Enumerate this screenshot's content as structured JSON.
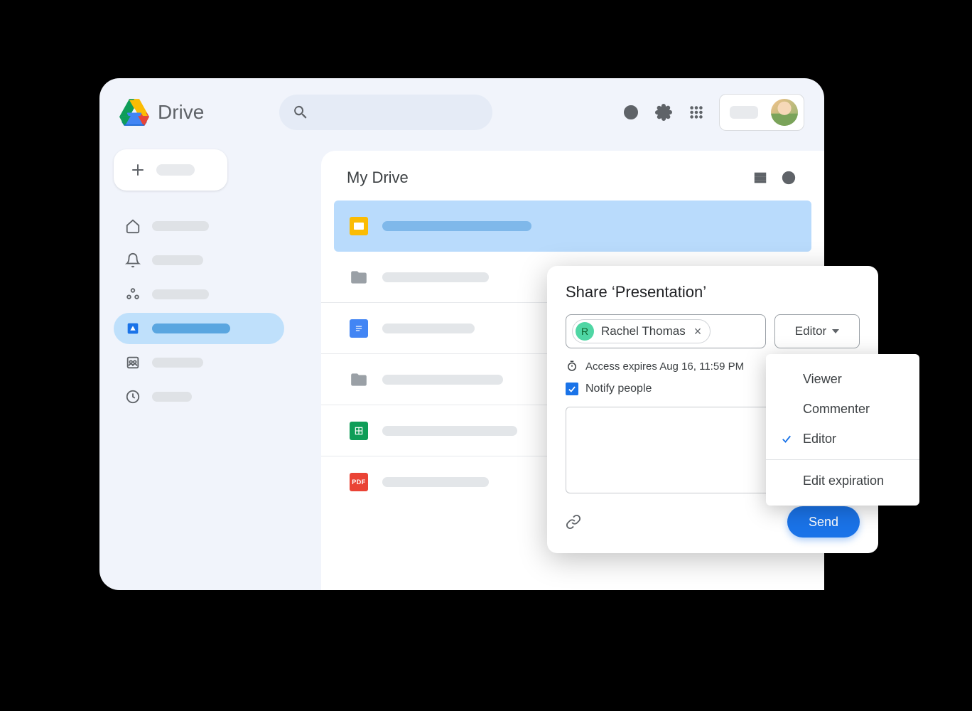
{
  "header": {
    "app_title": "Drive"
  },
  "sidebar": {
    "new_label": ""
  },
  "main": {
    "title": "My Drive"
  },
  "share": {
    "title": "Share ‘Presentation’",
    "chip_initial": "R",
    "chip_name": "Rachel Thomas",
    "role_selected": "Editor",
    "expire_text": "Access expires Aug 16, 11:59 PM",
    "notify_label": "Notify people",
    "send_label": "Send",
    "role_options": {
      "viewer": "Viewer",
      "commenter": "Commenter",
      "editor": "Editor",
      "edit_expiration": "Edit expiration"
    }
  }
}
